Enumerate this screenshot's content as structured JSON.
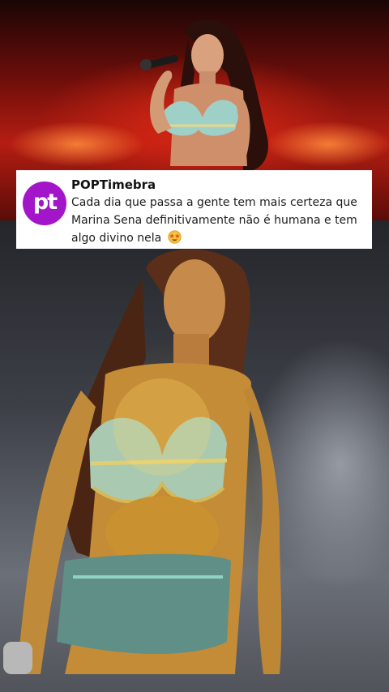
{
  "tweet": {
    "avatar_text": "pt",
    "account_name": "POPTimebra",
    "line1": "Cada dia que passa a gente tem mais certeza que",
    "line2": "Marina Sena definitivamente não é humana e tem",
    "line3": "algo divino nela",
    "emoji_icon": "star-struck-emoji-icon"
  },
  "colors": {
    "avatar_bg": "#a315c9",
    "card_bg": "#ffffff",
    "top_stage": "#b51d12",
    "bottom_stage": "#6b6f77"
  }
}
